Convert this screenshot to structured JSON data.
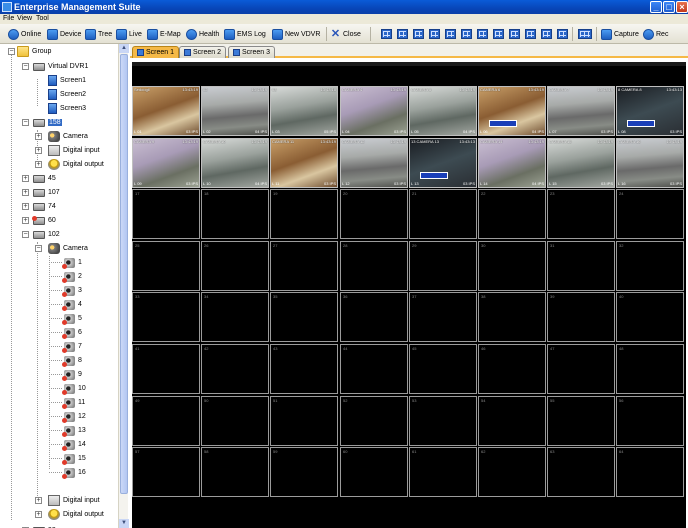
{
  "window": {
    "title": "Enterprise Management Suite"
  },
  "menu": {
    "items": [
      "File",
      "View",
      "Tool"
    ]
  },
  "toolbar": {
    "online": "Online",
    "device": "Device",
    "tree": "Tree",
    "live": "Live",
    "emap": "E-Map",
    "health": "Health",
    "emslog": "EMS Log",
    "newvdvr": "New VDVR",
    "close": "Close",
    "capture": "Capture",
    "rec": "Rec"
  },
  "tree": {
    "group": "Group",
    "virtual_dvr": "Virtual DVR1",
    "screens": [
      "Screen1",
      "Screen2",
      "Screen3"
    ],
    "dvr_158": "158",
    "camera": "Camera",
    "digital_input": "Digital input",
    "digital_output": "Digital output",
    "dvrs": [
      "45",
      "107",
      "74",
      "60",
      "102"
    ],
    "cameras_102": [
      "1",
      "2",
      "3",
      "4",
      "5",
      "6",
      "7",
      "8",
      "9",
      "10",
      "11",
      "12",
      "13",
      "14",
      "15",
      "16"
    ],
    "bottom_dvrs": [
      "93",
      "60"
    ]
  },
  "tabs": [
    "Screen 1",
    "Screen 2",
    "Screen 3"
  ],
  "grid": {
    "live_cells": [
      {
        "cap": "Sedoogil",
        "ts": "13:43:19",
        "rec": "L 01",
        "ips": "03 IPS"
      },
      {
        "cap": "02",
        "ts": "13:43:19",
        "rec": "L 02",
        "ips": "04 IPS"
      },
      {
        "cap": "03",
        "ts": "13:43:18",
        "rec": "L 03",
        "ips": "05 IPS"
      },
      {
        "cap": "CAMERA 4",
        "ts": "13:43:19",
        "rec": "L 04",
        "ips": "03 IPS"
      },
      {
        "cap": "CAMERA 5",
        "ts": "13:43:19",
        "rec": "L 05",
        "ips": "04 IPS"
      },
      {
        "cap": "CAMERA 6",
        "ts": "13:43:19",
        "rec": "L 06",
        "ips": "04 IPS"
      },
      {
        "cap": "CAMERA 7",
        "ts": "13:43:19",
        "rec": "L 07",
        "ips": "03 IPS"
      },
      {
        "cap": "8 CAMERA 8",
        "ts": "13:43:13",
        "rec": "L 08",
        "ips": "03 IPS"
      },
      {
        "cap": "CAMERA 9",
        "ts": "13:43:19",
        "rec": "L 09",
        "ips": "03 IPS"
      },
      {
        "cap": "CAMERA 10",
        "ts": "13:43:19",
        "rec": "L 10",
        "ips": "04 IPS"
      },
      {
        "cap": "CAMERA 11",
        "ts": "13:43:19",
        "rec": "L 11",
        "ips": "03 IPS"
      },
      {
        "cap": "CAMERA 12",
        "ts": "13:43:19",
        "rec": "L 12",
        "ips": "03 IPS"
      },
      {
        "cap": "13 CAMERA 13",
        "ts": "13:43:13",
        "rec": "L 13",
        "ips": "03 IPS"
      },
      {
        "cap": "CAMERA 14",
        "ts": "13:43:19",
        "rec": "L 14",
        "ips": "04 IPS"
      },
      {
        "cap": "CAMERA 15",
        "ts": "13:43:19",
        "rec": "L 15",
        "ips": "03 IPS"
      },
      {
        "cap": "CAMERA 16",
        "ts": "13:43:19",
        "rec": "L 16",
        "ips": "03 IPS"
      }
    ],
    "empty_cell_numbers": [
      "17",
      "18",
      "19",
      "20",
      "21",
      "22",
      "23",
      "24",
      "25",
      "26",
      "27",
      "28",
      "29",
      "30",
      "31",
      "32",
      "33",
      "34",
      "35",
      "36",
      "37",
      "38",
      "39",
      "40",
      "41",
      "42",
      "43",
      "44",
      "45",
      "46",
      "47",
      "48",
      "49",
      "50",
      "51",
      "52",
      "53",
      "54",
      "55",
      "56",
      "57",
      "58",
      "59",
      "60",
      "61",
      "62",
      "63",
      "64"
    ]
  }
}
